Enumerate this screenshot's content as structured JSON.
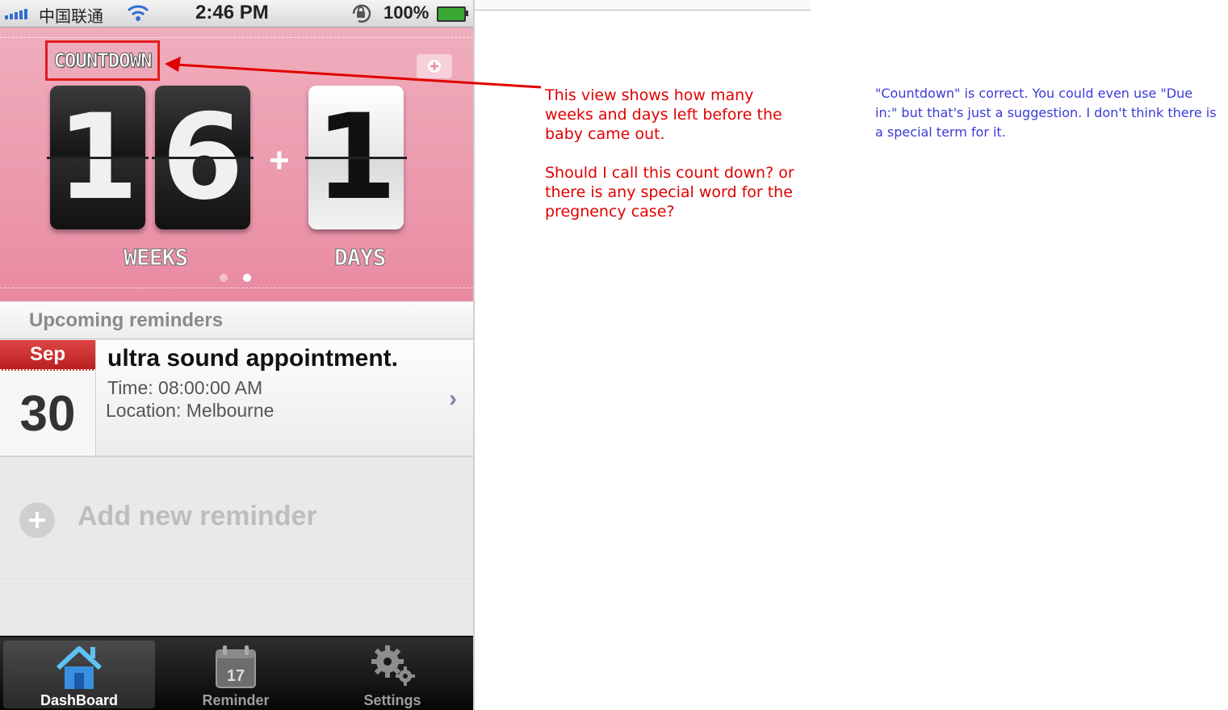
{
  "status_bar": {
    "carrier": "中国联通",
    "time": "2:46 PM",
    "battery": "100%"
  },
  "countdown": {
    "title": "COUNTDOWN",
    "weeks_digits": [
      "1",
      "6"
    ],
    "days_digits": [
      "1"
    ],
    "separator": "+",
    "weeks_label": "WEEKS",
    "days_label": "DAYS",
    "page_dots": {
      "count": 2,
      "active_index": 1
    }
  },
  "reminders": {
    "header": "Upcoming reminders",
    "items": [
      {
        "month": "Sep",
        "day": "30",
        "title": "ultra sound appointment.",
        "time": "Time: 08:00:00 AM",
        "location": "Location: Melbourne"
      }
    ],
    "add_label": "Add new reminder"
  },
  "tabbar": {
    "tabs": [
      {
        "label": "DashBoard",
        "icon": "home-icon",
        "active": true
      },
      {
        "label": "Reminder",
        "icon": "calendar-icon",
        "calendar_number": "17",
        "active": false
      },
      {
        "label": "Settings",
        "icon": "gear-icon",
        "active": false
      }
    ]
  },
  "annotations": {
    "question_lines": [
      "This view shows how many weeks and days left before the baby came out.",
      "Should I call this count down? or there is any special word for the pregnency case?"
    ],
    "answer": "\"Countdown\" is correct. You could even use \"Due in:\" but that's just a suggestion. I don't think there is a special term for it."
  },
  "colors": {
    "highlight_red": "#e21b1b",
    "note_red": "#e00000",
    "note_blue": "#3b3bd6",
    "hero_pink": "#eb94aa"
  }
}
